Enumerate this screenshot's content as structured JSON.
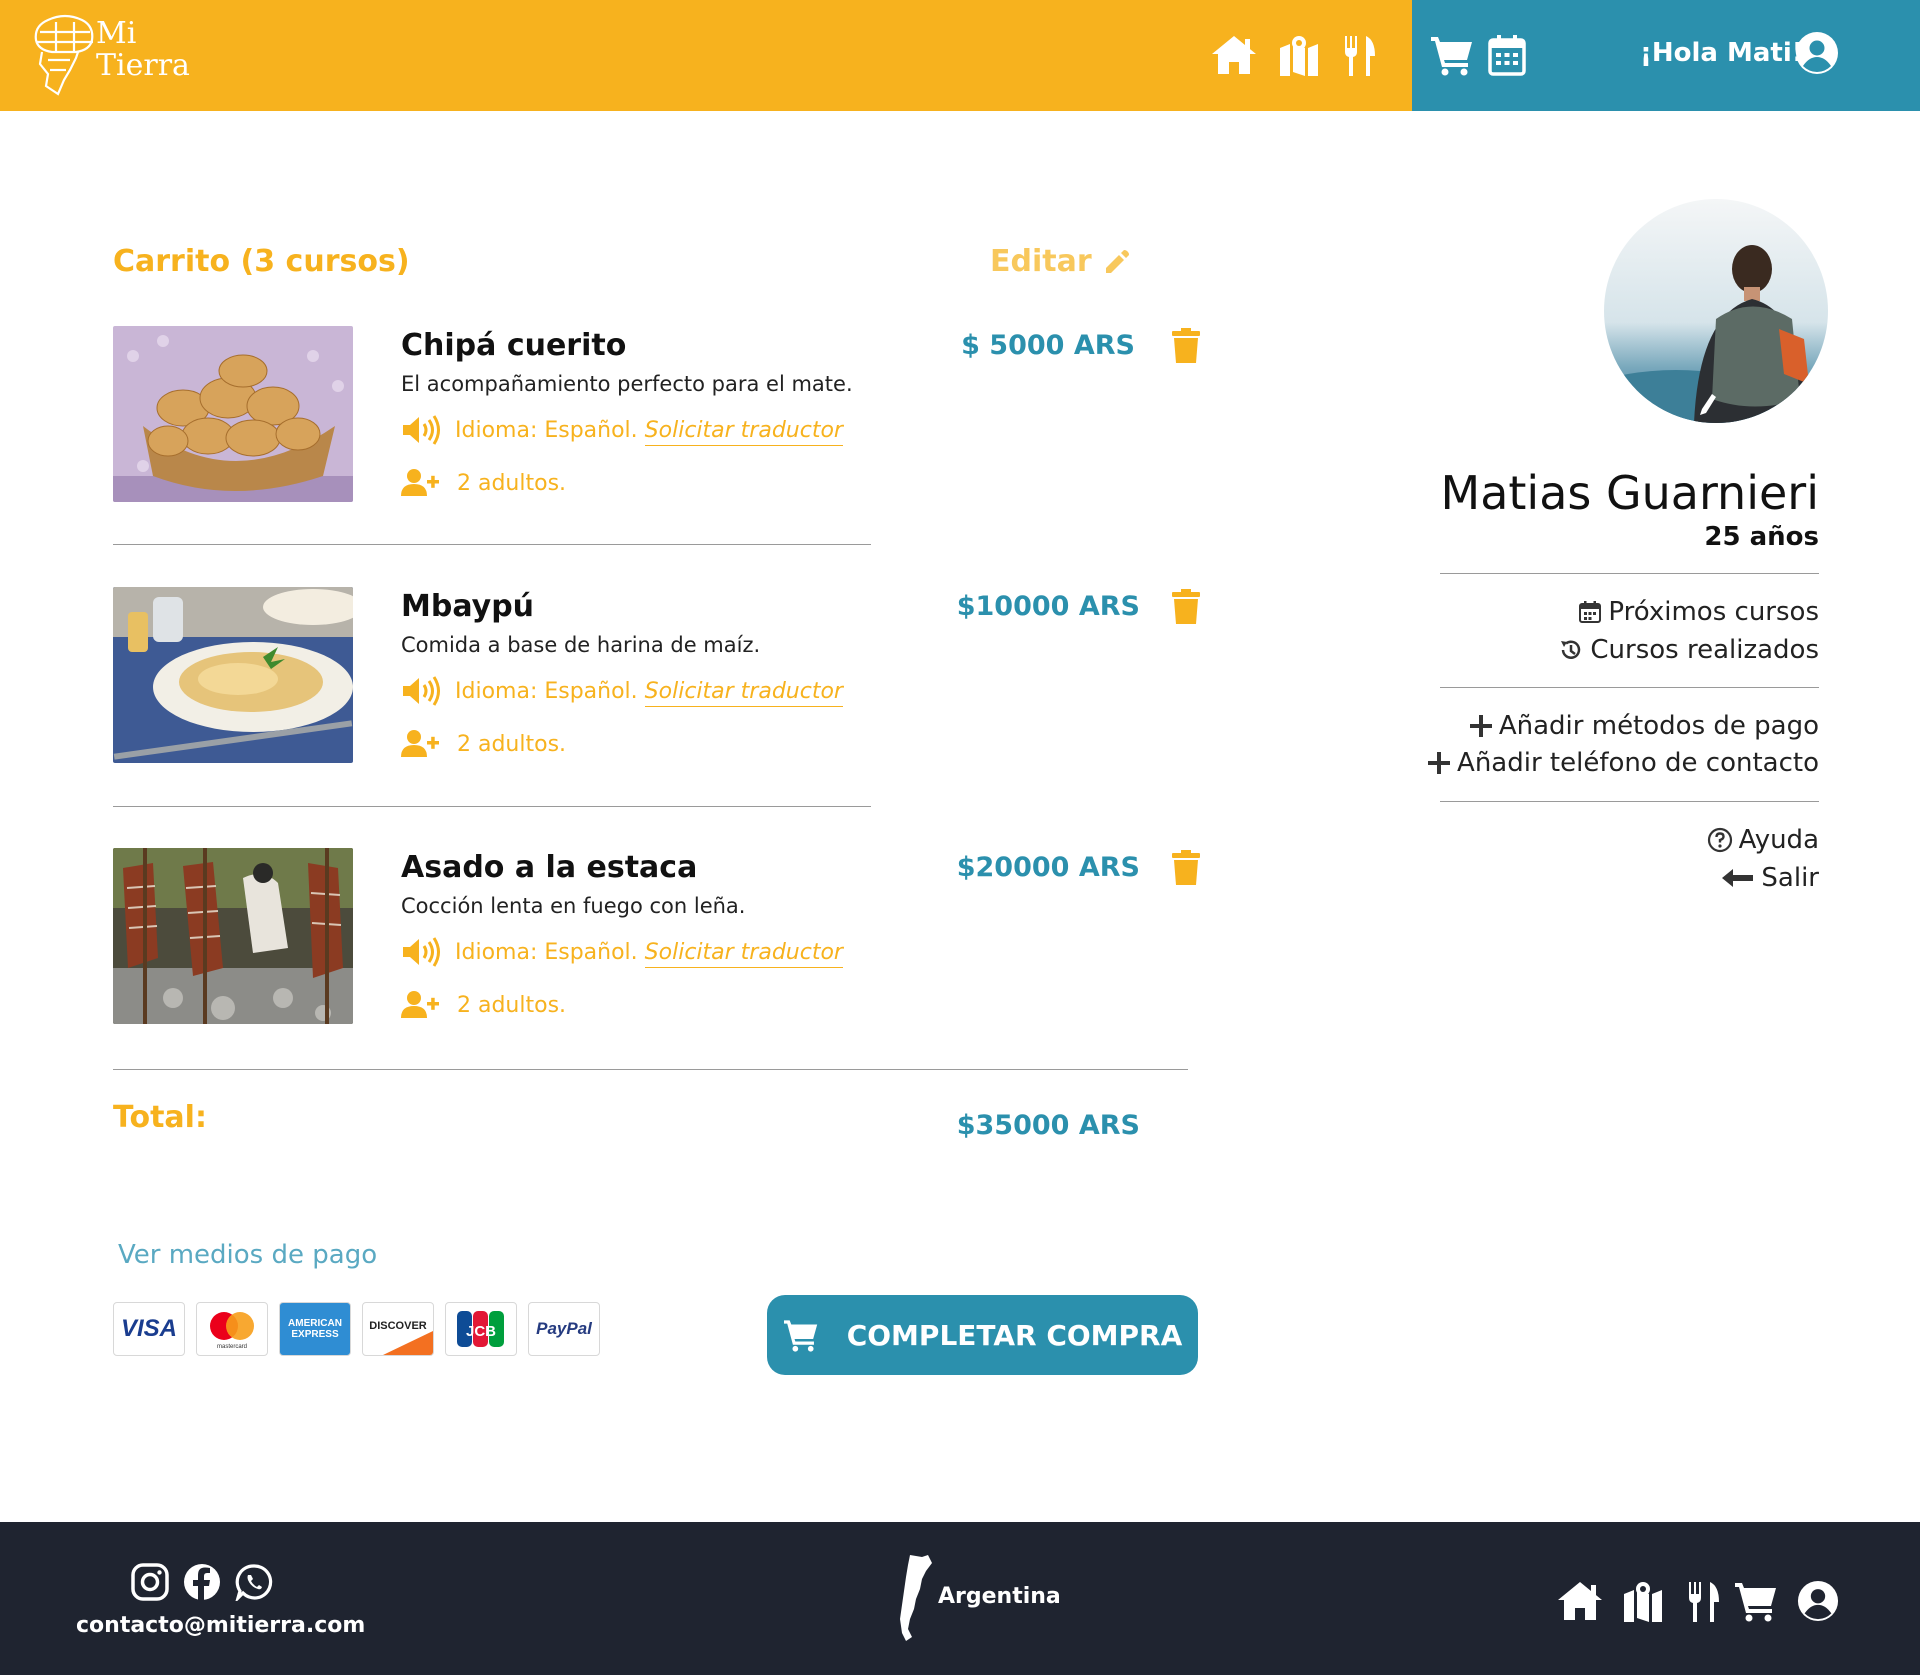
{
  "header": {
    "logo_line1": "Mi",
    "logo_line2": "Tierra",
    "greeting": "¡Hola Mati!",
    "icons": [
      "home-icon",
      "map-icon",
      "utensils-icon",
      "cart-icon",
      "calendar-icon",
      "user-circle-icon"
    ]
  },
  "cart": {
    "title": "Carrito (3 cursos)",
    "edit_label": "Editar",
    "items": [
      {
        "name": "Chipá cuerito",
        "description": "El acompañamiento perfecto para el mate.",
        "language": "Idioma: Español.",
        "translator_link": "Solicitar traductor",
        "guests": "2 adultos.",
        "price": "$ 5000 ARS"
      },
      {
        "name": "Mbaypú",
        "description": "Comida a base de harina de maíz.",
        "language": "Idioma: Español.",
        "translator_link": "Solicitar traductor",
        "guests": "2 adultos.",
        "price": "$10000 ARS"
      },
      {
        "name": "Asado a la estaca",
        "description": "Cocción lenta en fuego con leña.",
        "language": "Idioma: Español.",
        "translator_link": "Solicitar traductor",
        "guests": "2 adultos.",
        "price": "$20000 ARS"
      }
    ],
    "total_label": "Total:",
    "total_value": "$35000 ARS",
    "payment_link": "Ver medios de pago",
    "payment_cards": [
      "VISA",
      "mastercard",
      "AMERICAN EXPRESS",
      "DISCOVER",
      "JCB",
      "PayPal"
    ],
    "checkout_label": "COMPLETAR COMPRA"
  },
  "profile": {
    "name": "Matias Guarnieri",
    "age": "25 años",
    "links": {
      "upcoming": "Próximos cursos",
      "completed": "Cursos realizados",
      "add_payment": "Añadir métodos de pago",
      "add_phone": "Añadir teléfono de contacto",
      "help": "Ayuda",
      "logout": "Salir"
    }
  },
  "footer": {
    "email": "contacto@mitierra.com",
    "country": "Argentina"
  },
  "colors": {
    "brand_yellow": "#f7b21e",
    "brand_teal": "#2b90ad",
    "footer_dark": "#1f2430"
  }
}
